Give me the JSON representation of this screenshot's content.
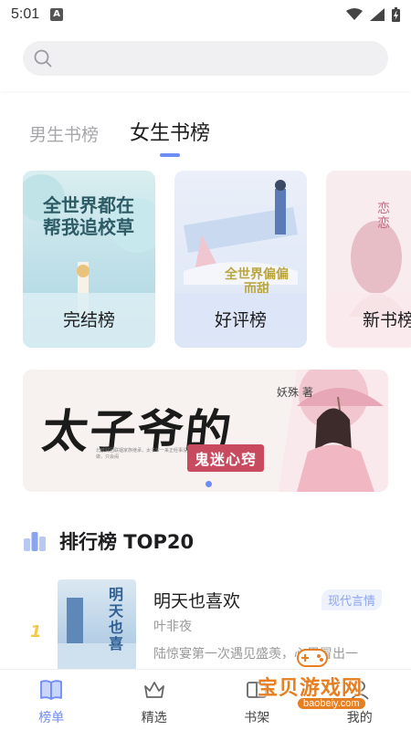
{
  "status_bar": {
    "time": "5:01",
    "notif_icon": "a-notification-icon"
  },
  "search": {
    "placeholder": ""
  },
  "tabs": [
    {
      "label": "男生书榜",
      "active": false
    },
    {
      "label": "女生书榜",
      "active": true
    }
  ],
  "rank_cards": [
    {
      "label": "完结榜",
      "cover_text": "全世界都在帮我追校草"
    },
    {
      "label": "好评榜",
      "cover_text": "全世界偏偏而甜"
    },
    {
      "label": "新书榜",
      "cover_text": "恋恋"
    }
  ],
  "banner": {
    "title": "太子爷的",
    "subtitle": "鬼迷心窍",
    "author": "妖殊 著",
    "blurb": "北欧财团联姻家族继承，太子爷一来正经事没做，只会闹"
  },
  "section": {
    "title": "排行榜 TOP20",
    "icon": "ranking-icon"
  },
  "books": [
    {
      "rank": "1",
      "name": "明天也喜欢",
      "tag": "现代言情",
      "author": "叶非夜",
      "desc": "陆惊宴第一次遇见盛羡，心里冒出一",
      "cover_text": "明天也喜"
    }
  ],
  "bottom_nav": [
    {
      "label": "榜单",
      "icon": "book-open-icon",
      "active": true
    },
    {
      "label": "精选",
      "icon": "crown-icon",
      "active": false
    },
    {
      "label": "书架",
      "icon": "bookshelf-icon",
      "active": false
    },
    {
      "label": "我的",
      "icon": "user-icon",
      "active": false
    }
  ],
  "watermark": {
    "text": "宝贝游戏网",
    "url": "baobeiy.com"
  },
  "colors": {
    "accent": "#6d8df5",
    "rank_gold": "#f2c94c",
    "tag_bg": "#eef2fd"
  }
}
